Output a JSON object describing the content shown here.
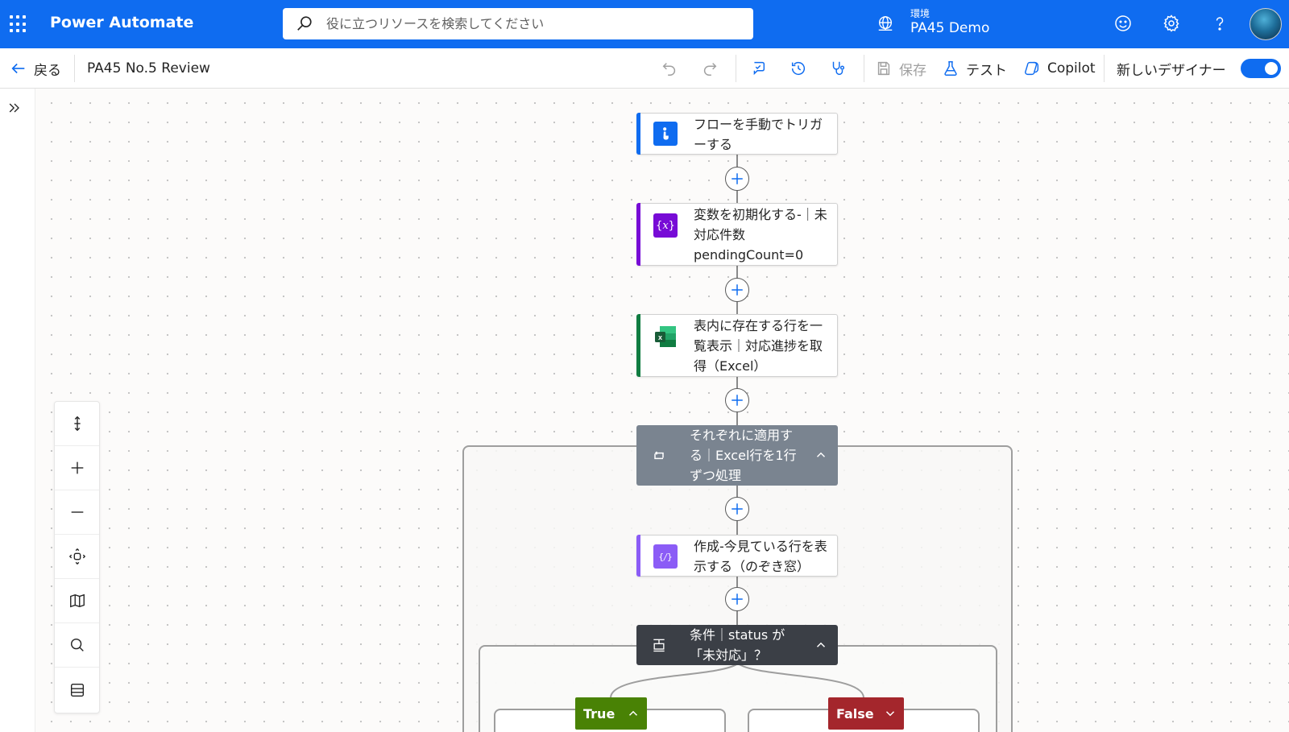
{
  "app": {
    "title": "Power Automate"
  },
  "search": {
    "placeholder": "役に立つリソースを検索してください"
  },
  "environment": {
    "label": "環境",
    "value": "PA45 Demo"
  },
  "toolbar": {
    "back_label": "戻る",
    "flow_name": "PA45 No.5 Review",
    "save_label": "保存",
    "test_label": "テスト",
    "copilot_label": "Copilot",
    "new_designer_label": "新しいデザイナー",
    "new_designer_on": true
  },
  "flow": {
    "steps": [
      {
        "title": "フローを手動でトリガーする",
        "accent": "#0f6cf0",
        "icon": "manual-trigger-icon"
      },
      {
        "title": "変数を初期化する-｜未対応件数 pendingCount=0",
        "accent": "#770bd6",
        "icon": "variable-icon"
      },
      {
        "title": "表内に存在する行を一覧表示｜対応進捗を取得（Excel）",
        "accent": "#107c41",
        "icon": "excel-icon"
      }
    ],
    "loop": {
      "title": "それぞれに適用する｜Excel行を1行ずつ処理",
      "color": "#7a8490",
      "icon": "loop-icon",
      "children": [
        {
          "title": "作成-今見ている行を表示する（のぞき窓）",
          "accent": "#8b5cf6",
          "icon": "compose-icon"
        }
      ],
      "condition": {
        "title": "条件｜status が「未対応」？",
        "color": "#3b3f46",
        "icon": "condition-icon",
        "true_label": "True",
        "true_color": "#498205",
        "false_label": "False",
        "false_color": "#a4262c"
      }
    }
  },
  "canvas_controls": [
    "fit-vertical-icon",
    "zoom-in-icon",
    "zoom-out-icon",
    "fit-view-icon",
    "minimap-icon",
    "search-icon",
    "list-view-icon"
  ]
}
